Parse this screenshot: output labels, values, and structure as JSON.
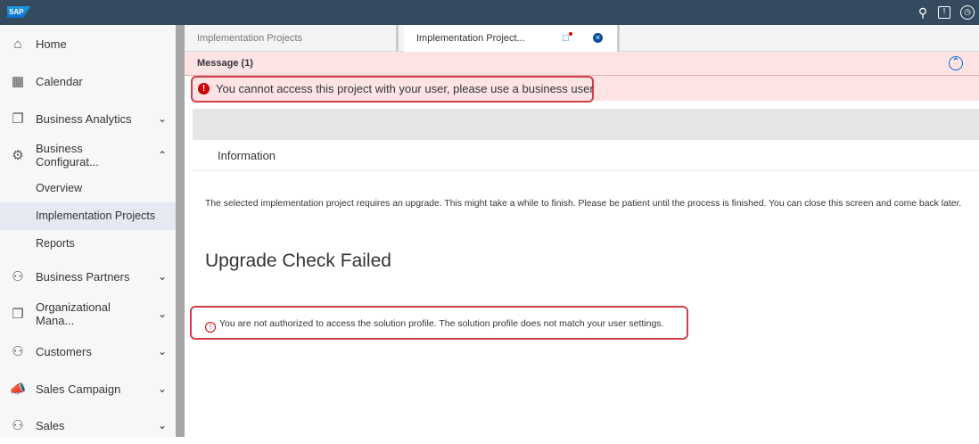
{
  "shell": {
    "logo": "SAP",
    "icons": [
      "search-icon",
      "feedback-icon",
      "clock-icon"
    ]
  },
  "sidebar": {
    "items": [
      {
        "label": "Home",
        "icon": "⌂"
      },
      {
        "label": "Calendar",
        "icon": "▦"
      },
      {
        "label": "Business Analytics",
        "icon": "❐"
      },
      {
        "label": "Business Configurat...",
        "icon": "⚙"
      },
      {
        "label": "Business Partners",
        "icon": "⚇"
      },
      {
        "label": "Organizational Mana...",
        "icon": "❐"
      },
      {
        "label": "Customers",
        "icon": "⚇"
      },
      {
        "label": "Sales Campaign",
        "icon": "📣"
      },
      {
        "label": "Sales",
        "icon": "⚇"
      }
    ],
    "subitems": [
      "Overview",
      "Implementation Projects",
      "Reports"
    ]
  },
  "tabs": [
    "Implementation Projects",
    "Implementation Project..."
  ],
  "message": {
    "header": "Message (1)",
    "error": "You cannot access this project with your user, please use a business user"
  },
  "section": {
    "tab": "Information",
    "info": "The selected implementation project requires an upgrade. This might take a while to finish. Please be patient until the process is finished. You can close this screen and come back later.",
    "title": "Upgrade Check Failed",
    "warning": "You are not authorized to access the solution profile. The solution profile does not match your user settings."
  }
}
